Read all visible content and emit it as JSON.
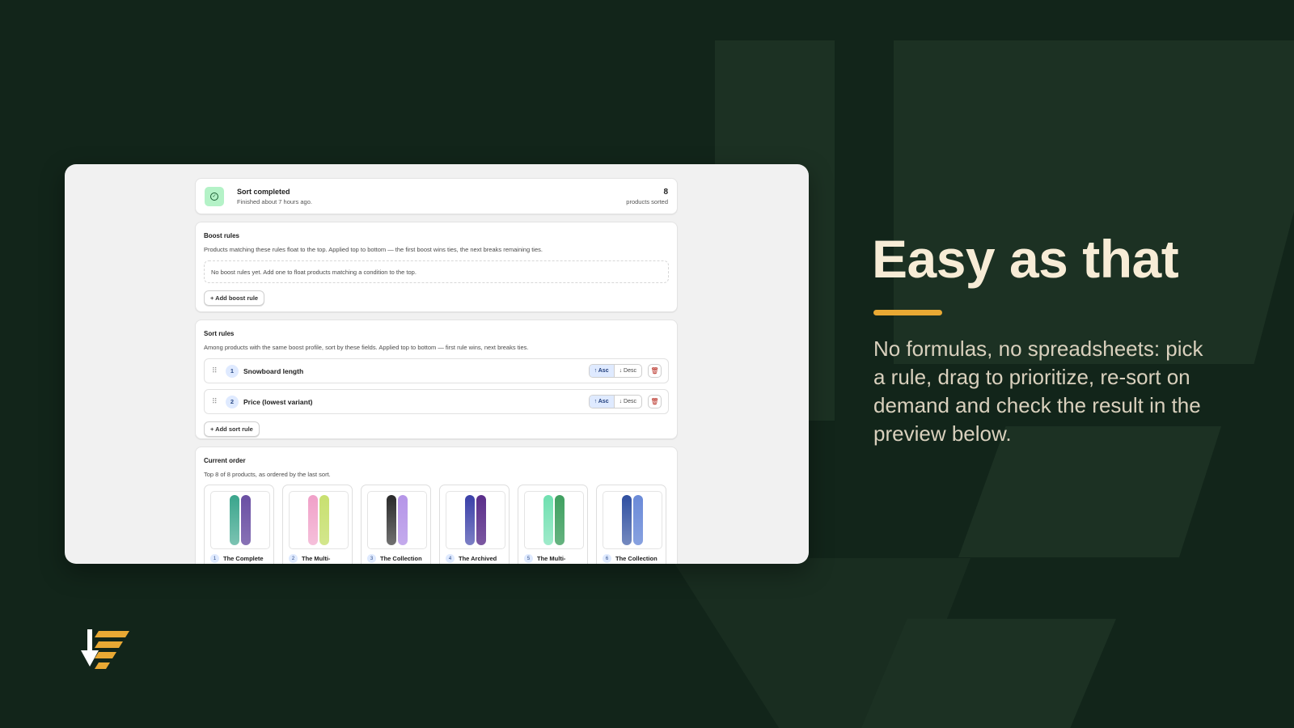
{
  "app": {
    "status": {
      "title": "Sort completed",
      "subtitle": "Finished about 7 hours ago.",
      "count": "8",
      "count_label": "products sorted"
    },
    "boost_rules": {
      "title": "Boost rules",
      "description": "Products matching these rules float to the top. Applied top to bottom — the first boost wins ties, the next breaks remaining ties.",
      "empty_text": "No boost rules yet. Add one to float products matching a condition to the top.",
      "add_label": "+ Add boost rule"
    },
    "sort_rules": {
      "title": "Sort rules",
      "description": "Among products with the same boost profile, sort by these fields. Applied top to bottom — first rule wins, next breaks ties.",
      "rules": [
        {
          "number": "1",
          "label": "Snowboard length",
          "asc": "↑ Asc",
          "desc": "↓ Desc"
        },
        {
          "number": "2",
          "label": "Price (lowest variant)",
          "asc": "↑ Asc",
          "desc": "↓ Desc"
        }
      ],
      "add_label": "+ Add sort rule"
    },
    "current_order": {
      "title": "Current order",
      "description": "Top 8 of 8 products, as ordered by the last sort.",
      "products": [
        {
          "number": "1",
          "name": "The Complete",
          "colors": [
            "#3aa58c",
            "#6a4fa3"
          ]
        },
        {
          "number": "2",
          "name": "The Multi-",
          "colors": [
            "#f0a0c8",
            "#c8e070"
          ]
        },
        {
          "number": "3",
          "name": "The Collection",
          "colors": [
            "#2a2a2a",
            "#b595e8"
          ]
        },
        {
          "number": "4",
          "name": "The Archived",
          "colors": [
            "#3a3fa8",
            "#5a2e8a"
          ]
        },
        {
          "number": "5",
          "name": "The Multi-",
          "colors": [
            "#6fe0b0",
            "#3fa060"
          ]
        },
        {
          "number": "6",
          "name": "The Collection",
          "colors": [
            "#2f4fa0",
            "#6a8ad8"
          ]
        }
      ]
    }
  },
  "marketing": {
    "headline": "Easy as that",
    "body": "No formulas, no spreadsheets: pick a rule, drag to prioritize, re-sort on demand and check the result in the preview below.",
    "accent_color": "#e9a934"
  },
  "icons": {
    "status": "check-circle-icon",
    "drag": "drag-handle-icon",
    "delete": "trash-icon",
    "logo": "sort-down-logo-icon"
  }
}
